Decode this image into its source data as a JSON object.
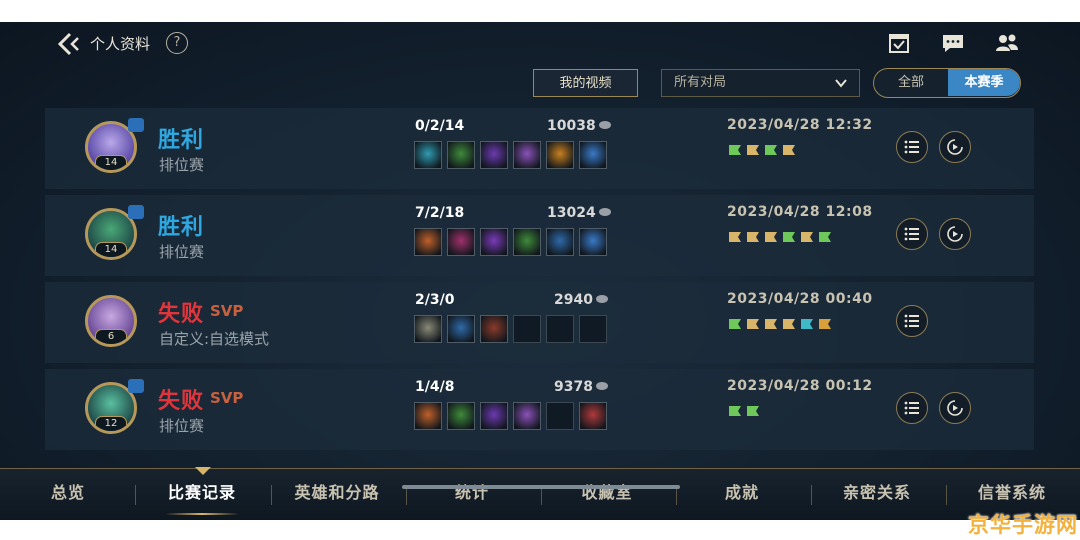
{
  "header": {
    "title": "个人资料",
    "help": "?"
  },
  "top_icons": [
    "calendar-check-icon",
    "chat-icon",
    "friends-icon"
  ],
  "filters": {
    "my_video": "我的视频",
    "mode_select": "所有对局",
    "seg_all": "全部",
    "seg_season": "本赛季"
  },
  "matches": [
    {
      "result": "胜利",
      "outcome": "win",
      "svp": "",
      "mode": "排位赛",
      "level": "14",
      "kda": "0/2/14",
      "gold": "10038",
      "date": "2023/04/28 12:32",
      "replay": true,
      "items": [
        "#2f9bb0",
        "#3f8a3a",
        "#6b3ab0",
        "#8a52b8",
        "#c8801e",
        "#3a7ac8"
      ]
    },
    {
      "result": "胜利",
      "outcome": "win",
      "svp": "",
      "mode": "排位赛",
      "level": "14",
      "kda": "7/2/18",
      "gold": "13024",
      "date": "2023/04/28 12:08",
      "replay": true,
      "items": [
        "#c0602a",
        "#a0306a",
        "#7a3ab8",
        "#3f8a3a",
        "#2f6aa8",
        "#3a7ac8"
      ]
    },
    {
      "result": "失败",
      "outcome": "lose",
      "svp": "SVP",
      "mode": "自定义:自选模式",
      "level": "6",
      "kda": "2/3/0",
      "gold": "2940",
      "date": "2023/04/28 00:40",
      "replay": false,
      "items": [
        "#8a8a78",
        "#2f6aa8",
        "#8a3a2a",
        "",
        "",
        ""
      ]
    },
    {
      "result": "失败",
      "outcome": "lose",
      "svp": "SVP",
      "mode": "排位赛",
      "level": "12",
      "kda": "1/4/8",
      "gold": "9378",
      "date": "2023/04/28 00:12",
      "replay": true,
      "items": [
        "#c0602a",
        "#3f8a3a",
        "#6b3ab0",
        "#8a52b8",
        "",
        "#b03a3a"
      ]
    }
  ],
  "tabs": [
    "总览",
    "比赛记录",
    "英雄和分路",
    "统计",
    "收藏室",
    "成就",
    "亲密关系",
    "信誉系统"
  ],
  "active_tab": 1,
  "watermark": "京华手游网",
  "colors": {
    "win": "#2fa7e0",
    "lose": "#e0353a",
    "accent_gold": "#b6985a",
    "season_blue": "#3b86c4"
  }
}
